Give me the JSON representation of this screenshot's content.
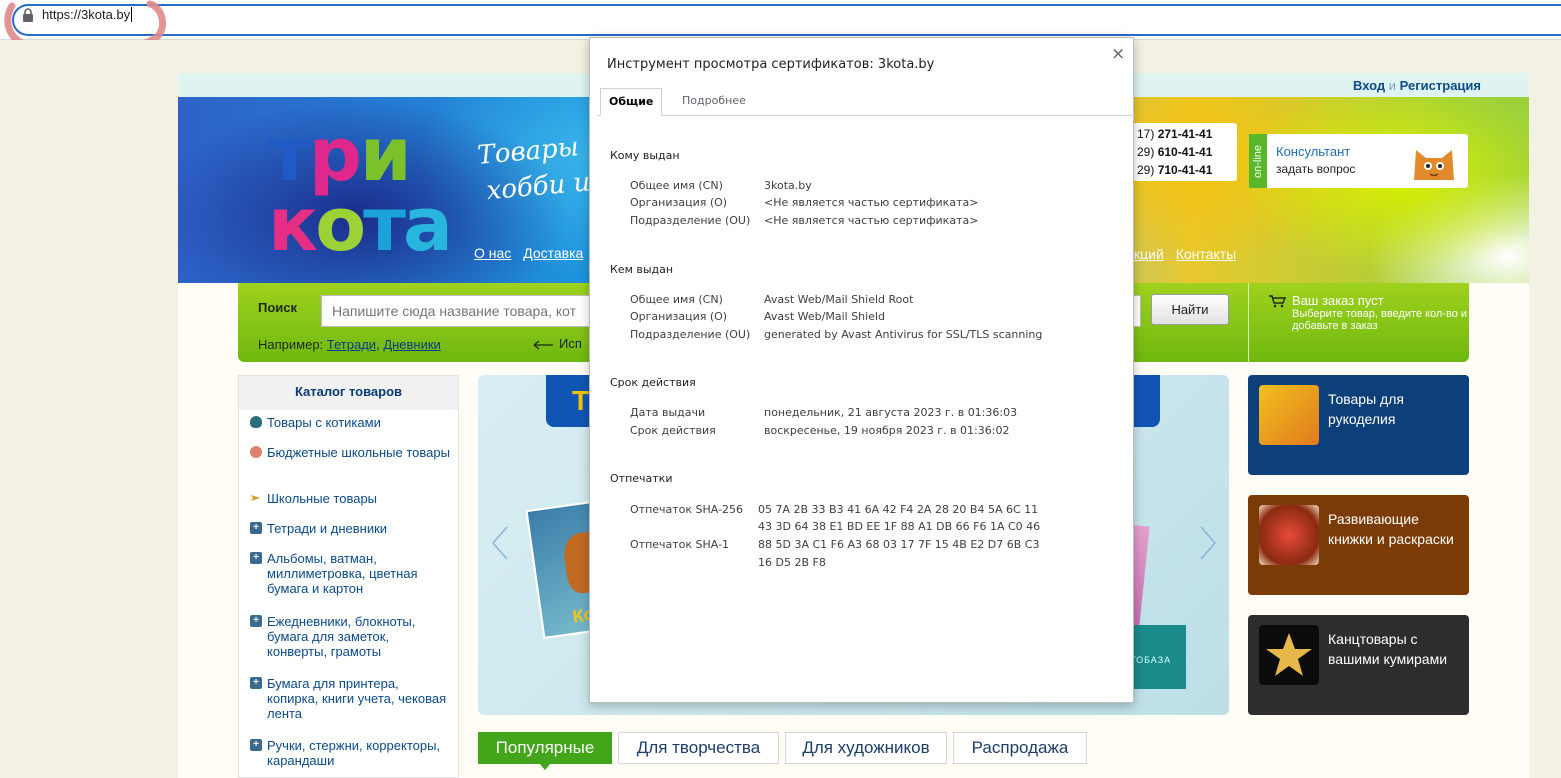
{
  "browser": {
    "url": "https://3kota.by"
  },
  "site": {
    "auth": {
      "login": "Вход",
      "and": "и",
      "register": "Регистрация"
    },
    "logo": {
      "line1": "три",
      "line2": "кота"
    },
    "tagline": {
      "line1": "Товары",
      "line2": "хобби и"
    },
    "nav_left": [
      "О нас",
      "Доставка"
    ],
    "nav_right": [
      "кций",
      "Контакты"
    ],
    "phones": [
      {
        "prefix": "17)",
        "number": "271-41-41"
      },
      {
        "prefix": "29)",
        "number": "610-41-41"
      },
      {
        "prefix": "29)",
        "number": "710-41-41"
      }
    ],
    "consultant": {
      "online": "on-line",
      "title": "Консультант",
      "subtitle": "задать вопрос"
    },
    "search": {
      "label": "Поиск",
      "placeholder": "Напишите сюда название товара, кот",
      "button": "Найти",
      "example_prefix": "Например:",
      "example_links": [
        "Тетради",
        "Дневники"
      ],
      "hint": "Исп"
    },
    "cart": {
      "title": "Ваш заказ пуст",
      "text": "Выберите товар, введите кол-во и добавьте в заказ"
    },
    "catalog": {
      "title": "Каталог товаров",
      "items": [
        {
          "label": "Товары с котиками",
          "icon": "cat-icon"
        },
        {
          "label": "Бюджетные школьные товары",
          "icon": "ball-icon"
        },
        {
          "label": "Школьные товары",
          "icon": "pencil-icon"
        },
        {
          "label": "Тетради и дневники",
          "icon": "plus-icon"
        },
        {
          "label": "Альбомы, ватман, миллиметровка, цветная бумага и картон",
          "icon": "plus-icon"
        },
        {
          "label": "Ежедневники, блокноты, бумага для заметок, конверты, грамоты",
          "icon": "plus-icon"
        },
        {
          "label": "Бумага для принтера, копирка, книги учета, чековая лента",
          "icon": "plus-icon"
        },
        {
          "label": "Ручки, стержни, корректоры, карандаши",
          "icon": "plus-icon"
        }
      ]
    },
    "banner": {
      "title": "Т",
      "book_text": "Ко",
      "pillow_text": "ОТОБАЗА"
    },
    "promos": [
      {
        "label": "Товары для рукоделия",
        "color": "#0d3f7a"
      },
      {
        "label": "Развивающие книжки и раскраски",
        "color": "#7a3b06"
      },
      {
        "label": "Канцтовары с вашими кумирами",
        "color": "#2d2d2d"
      }
    ],
    "tabs": [
      "Популярные",
      "Для творчества",
      "Для художников",
      "Распродажа"
    ]
  },
  "certificate_viewer": {
    "title": "Инструмент просмотра сертификатов: 3kota.by",
    "close": "×",
    "tabs": [
      "Общие",
      "Подробнее"
    ],
    "issued_to": {
      "heading": "Кому выдан",
      "rows": [
        {
          "label": "Общее имя (CN)",
          "value": "3kota.by"
        },
        {
          "label": "Организация (O)",
          "value": "<Не является частью сертификата>"
        },
        {
          "label": "Подразделение (OU)",
          "value": "<Не является частью сертификата>"
        }
      ]
    },
    "issued_by": {
      "heading": "Кем выдан",
      "rows": [
        {
          "label": "Общее имя (CN)",
          "value": "Avast Web/Mail Shield Root"
        },
        {
          "label": "Организация (O)",
          "value": "Avast Web/Mail Shield"
        },
        {
          "label": "Подразделение (OU)",
          "value": "generated by Avast Antivirus for SSL/TLS scanning"
        }
      ]
    },
    "validity": {
      "heading": "Срок действия",
      "rows": [
        {
          "label": "Дата выдачи",
          "value": "понедельник, 21 августа 2023 г. в 01:36:03"
        },
        {
          "label": "Срок действия",
          "value": "воскресенье, 19 ноября 2023 г. в 01:36:02"
        }
      ]
    },
    "fingerprints": {
      "heading": "Отпечатки",
      "sha256": {
        "label": "Отпечаток SHA-256",
        "line1": "05 7A 2B 33 B3 41 6A 42 F4 2A 28 20 B4 5A 6C 11",
        "line2": "43 3D 64 38 E1 BD EE 1F 88 A1 DB 66 F6 1A C0 46"
      },
      "sha1": {
        "label": "Отпечаток SHA-1",
        "line1": "88 5D 3A C1 F6 A3 68 03 17 7F 15 4B E2 D7 6B C3",
        "line2": "16 D5 2B F8"
      }
    }
  }
}
